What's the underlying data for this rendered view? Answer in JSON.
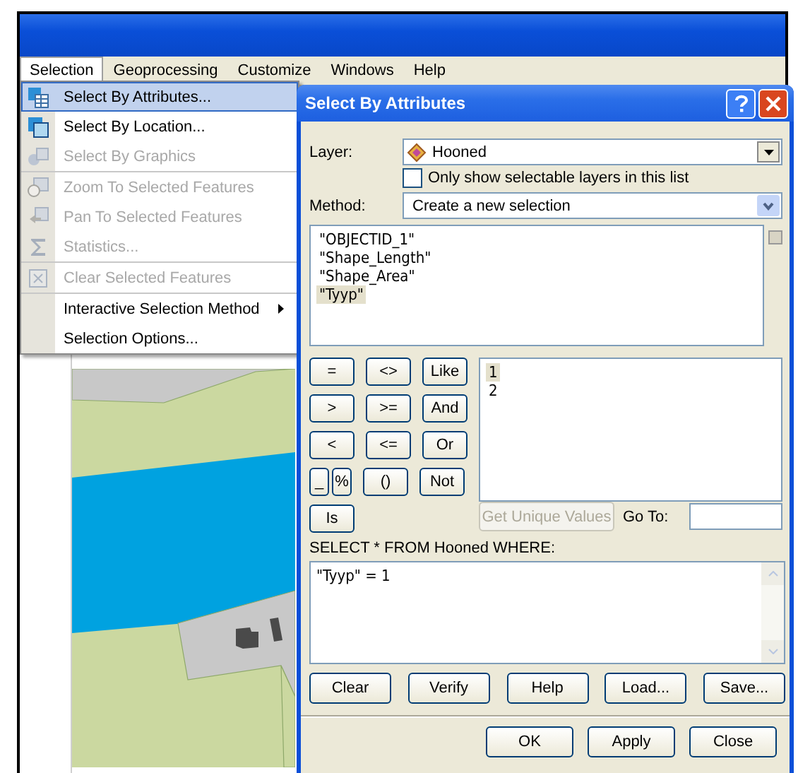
{
  "menu_bar": [
    {
      "label": "Selection",
      "selected": true
    },
    {
      "label": "Geoprocessing",
      "selected": false
    },
    {
      "label": "Customize",
      "selected": false
    },
    {
      "label": "Windows",
      "selected": false
    },
    {
      "label": "Help",
      "selected": false
    }
  ],
  "selection_menu": {
    "items": [
      {
        "label": "Select By Attributes...",
        "kind": "tool",
        "disabled": false,
        "selected": true,
        "separator_before": false
      },
      {
        "label": "Select By Location...",
        "kind": "tool",
        "disabled": false,
        "selected": false,
        "separator_before": false
      },
      {
        "label": "Select By Graphics",
        "kind": "tool",
        "disabled": true,
        "selected": false,
        "separator_before": false
      },
      {
        "label": "Zoom To Selected Features",
        "kind": "tool",
        "disabled": true,
        "selected": false,
        "separator_before": true
      },
      {
        "label": "Pan To Selected Features",
        "kind": "tool",
        "disabled": true,
        "selected": false,
        "separator_before": false
      },
      {
        "label": "Statistics...",
        "kind": "tool",
        "disabled": true,
        "selected": false,
        "separator_before": false
      },
      {
        "label": "Clear Selected Features",
        "kind": "tool",
        "disabled": true,
        "selected": false,
        "separator_before": true
      },
      {
        "label": "Interactive Selection Method",
        "kind": "submenu",
        "disabled": false,
        "selected": false,
        "separator_before": true
      },
      {
        "label": "Selection Options...",
        "kind": "plain",
        "disabled": false,
        "selected": false,
        "separator_before": false
      }
    ]
  },
  "dialog": {
    "title": "Select By Attributes",
    "layer_label": "Layer:",
    "layer": "Hooned",
    "selectable_only": {
      "label": "Only show selectable layers in this list",
      "checked": false
    },
    "method_label": "Method:",
    "method": "Create a new selection",
    "fields": [
      {
        "label": "\"OBJECTID_1\"",
        "selected": false
      },
      {
        "label": "\"Shape_Length\"",
        "selected": false
      },
      {
        "label": "\"Shape_Area\"",
        "selected": false
      },
      {
        "label": "\"Tyyp\"",
        "selected": true
      }
    ],
    "operators": [
      [
        {
          "label": "=",
          "kind": "full"
        },
        {
          "label": "<>",
          "kind": "full"
        },
        {
          "label": "Like",
          "kind": "full"
        }
      ],
      [
        {
          "label": ">",
          "kind": "full"
        },
        {
          "label": ">=",
          "kind": "full"
        },
        {
          "label": "And",
          "kind": "full"
        }
      ],
      [
        {
          "label": "<",
          "kind": "full"
        },
        {
          "label": "<=",
          "kind": "full"
        },
        {
          "label": "Or",
          "kind": "full"
        }
      ],
      [
        {
          "label": "_",
          "kind": "half"
        },
        {
          "label": "%",
          "kind": "half"
        },
        {
          "label": "()",
          "kind": "full"
        },
        {
          "label": "Not",
          "kind": "full"
        }
      ],
      [
        {
          "label": "Is",
          "kind": "full"
        }
      ]
    ],
    "values": [
      {
        "label": "1",
        "selected": true
      },
      {
        "label": "2",
        "selected": false
      }
    ],
    "unique_values_button": {
      "label": "Get Unique Values",
      "disabled": true
    },
    "goto_label": "Go To:",
    "query_label": "SELECT * FROM Hooned WHERE:",
    "expression": "\"Tyyp\" = 1",
    "query_buttons": [
      "Clear",
      "Verify",
      "Help",
      "Load...",
      "Save..."
    ],
    "footer_buttons": [
      "OK",
      "Apply",
      "Close"
    ]
  }
}
